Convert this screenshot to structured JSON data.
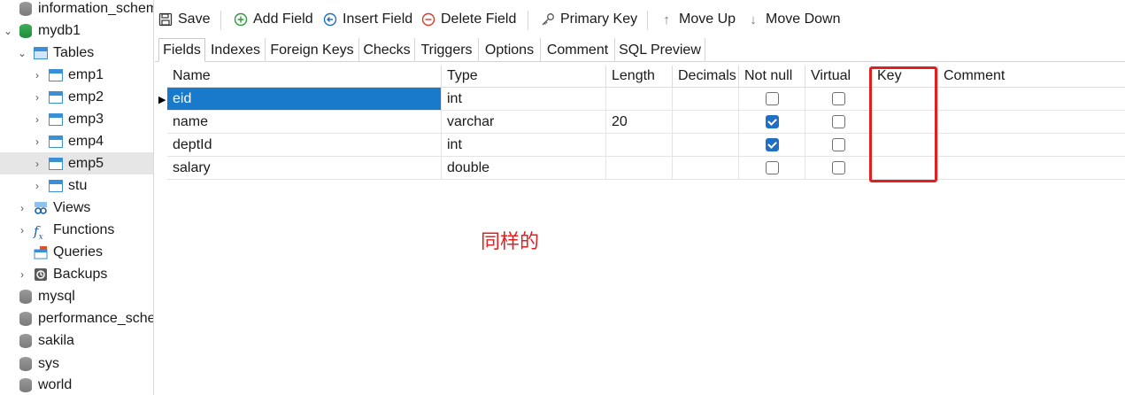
{
  "sidebar": {
    "items": [
      {
        "label": "information_schema",
        "icon": "database-icon",
        "level": 0
      },
      {
        "label": "mydb1",
        "icon": "database-open-icon",
        "level": 0,
        "expanded": true
      },
      {
        "label": "Tables",
        "icon": "tables-folder-icon",
        "level": 1,
        "expanded": true
      },
      {
        "label": "emp1",
        "icon": "table-icon",
        "level": 2
      },
      {
        "label": "emp2",
        "icon": "table-icon",
        "level": 2
      },
      {
        "label": "emp3",
        "icon": "table-icon",
        "level": 2
      },
      {
        "label": "emp4",
        "icon": "table-icon",
        "level": 2
      },
      {
        "label": "emp5",
        "icon": "table-icon",
        "level": 2,
        "selected": true
      },
      {
        "label": "stu",
        "icon": "table-icon",
        "level": 2
      },
      {
        "label": "Views",
        "icon": "views-icon",
        "level": 1
      },
      {
        "label": "Functions",
        "icon": "function-icon",
        "level": 1
      },
      {
        "label": "Queries",
        "icon": "queries-icon",
        "level": 1
      },
      {
        "label": "Backups",
        "icon": "backup-icon",
        "level": 1
      },
      {
        "label": "mysql",
        "icon": "database-icon",
        "level": 0
      },
      {
        "label": "performance_schema",
        "icon": "database-icon",
        "level": 0
      },
      {
        "label": "sakila",
        "icon": "database-icon",
        "level": 0
      },
      {
        "label": "sys",
        "icon": "database-icon",
        "level": 0
      },
      {
        "label": "world",
        "icon": "database-icon",
        "level": 0
      }
    ]
  },
  "toolbar": {
    "save": "Save",
    "add_field": "Add Field",
    "insert_field": "Insert Field",
    "delete_field": "Delete Field",
    "primary_key": "Primary Key",
    "move_up": "Move Up",
    "move_down": "Move Down"
  },
  "tabs": [
    "Fields",
    "Indexes",
    "Foreign Keys",
    "Checks",
    "Triggers",
    "Options",
    "Comment",
    "SQL Preview"
  ],
  "grid": {
    "headers": {
      "name": "Name",
      "type": "Type",
      "length": "Length",
      "decimals": "Decimals",
      "not_null": "Not null",
      "virtual": "Virtual",
      "key": "Key",
      "comment": "Comment"
    },
    "rows": [
      {
        "name": "eid",
        "type": "int",
        "length": "",
        "decimals": "",
        "not_null": false,
        "virtual": false,
        "key": "",
        "comment": ""
      },
      {
        "name": "name",
        "type": "varchar",
        "length": "20",
        "decimals": "",
        "not_null": true,
        "virtual": false,
        "key": "",
        "comment": ""
      },
      {
        "name": "deptId",
        "type": "int",
        "length": "",
        "decimals": "",
        "not_null": true,
        "virtual": false,
        "key": "",
        "comment": ""
      },
      {
        "name": "salary",
        "type": "double",
        "length": "",
        "decimals": "",
        "not_null": false,
        "virtual": false,
        "key": "",
        "comment": ""
      }
    ]
  },
  "annotation": {
    "text": "同样的",
    "color": "#e02020"
  },
  "colors": {
    "selection": "#1979ca",
    "checkbox_checked": "#1f6fc5",
    "tree_selected": "#e6e6e6"
  }
}
